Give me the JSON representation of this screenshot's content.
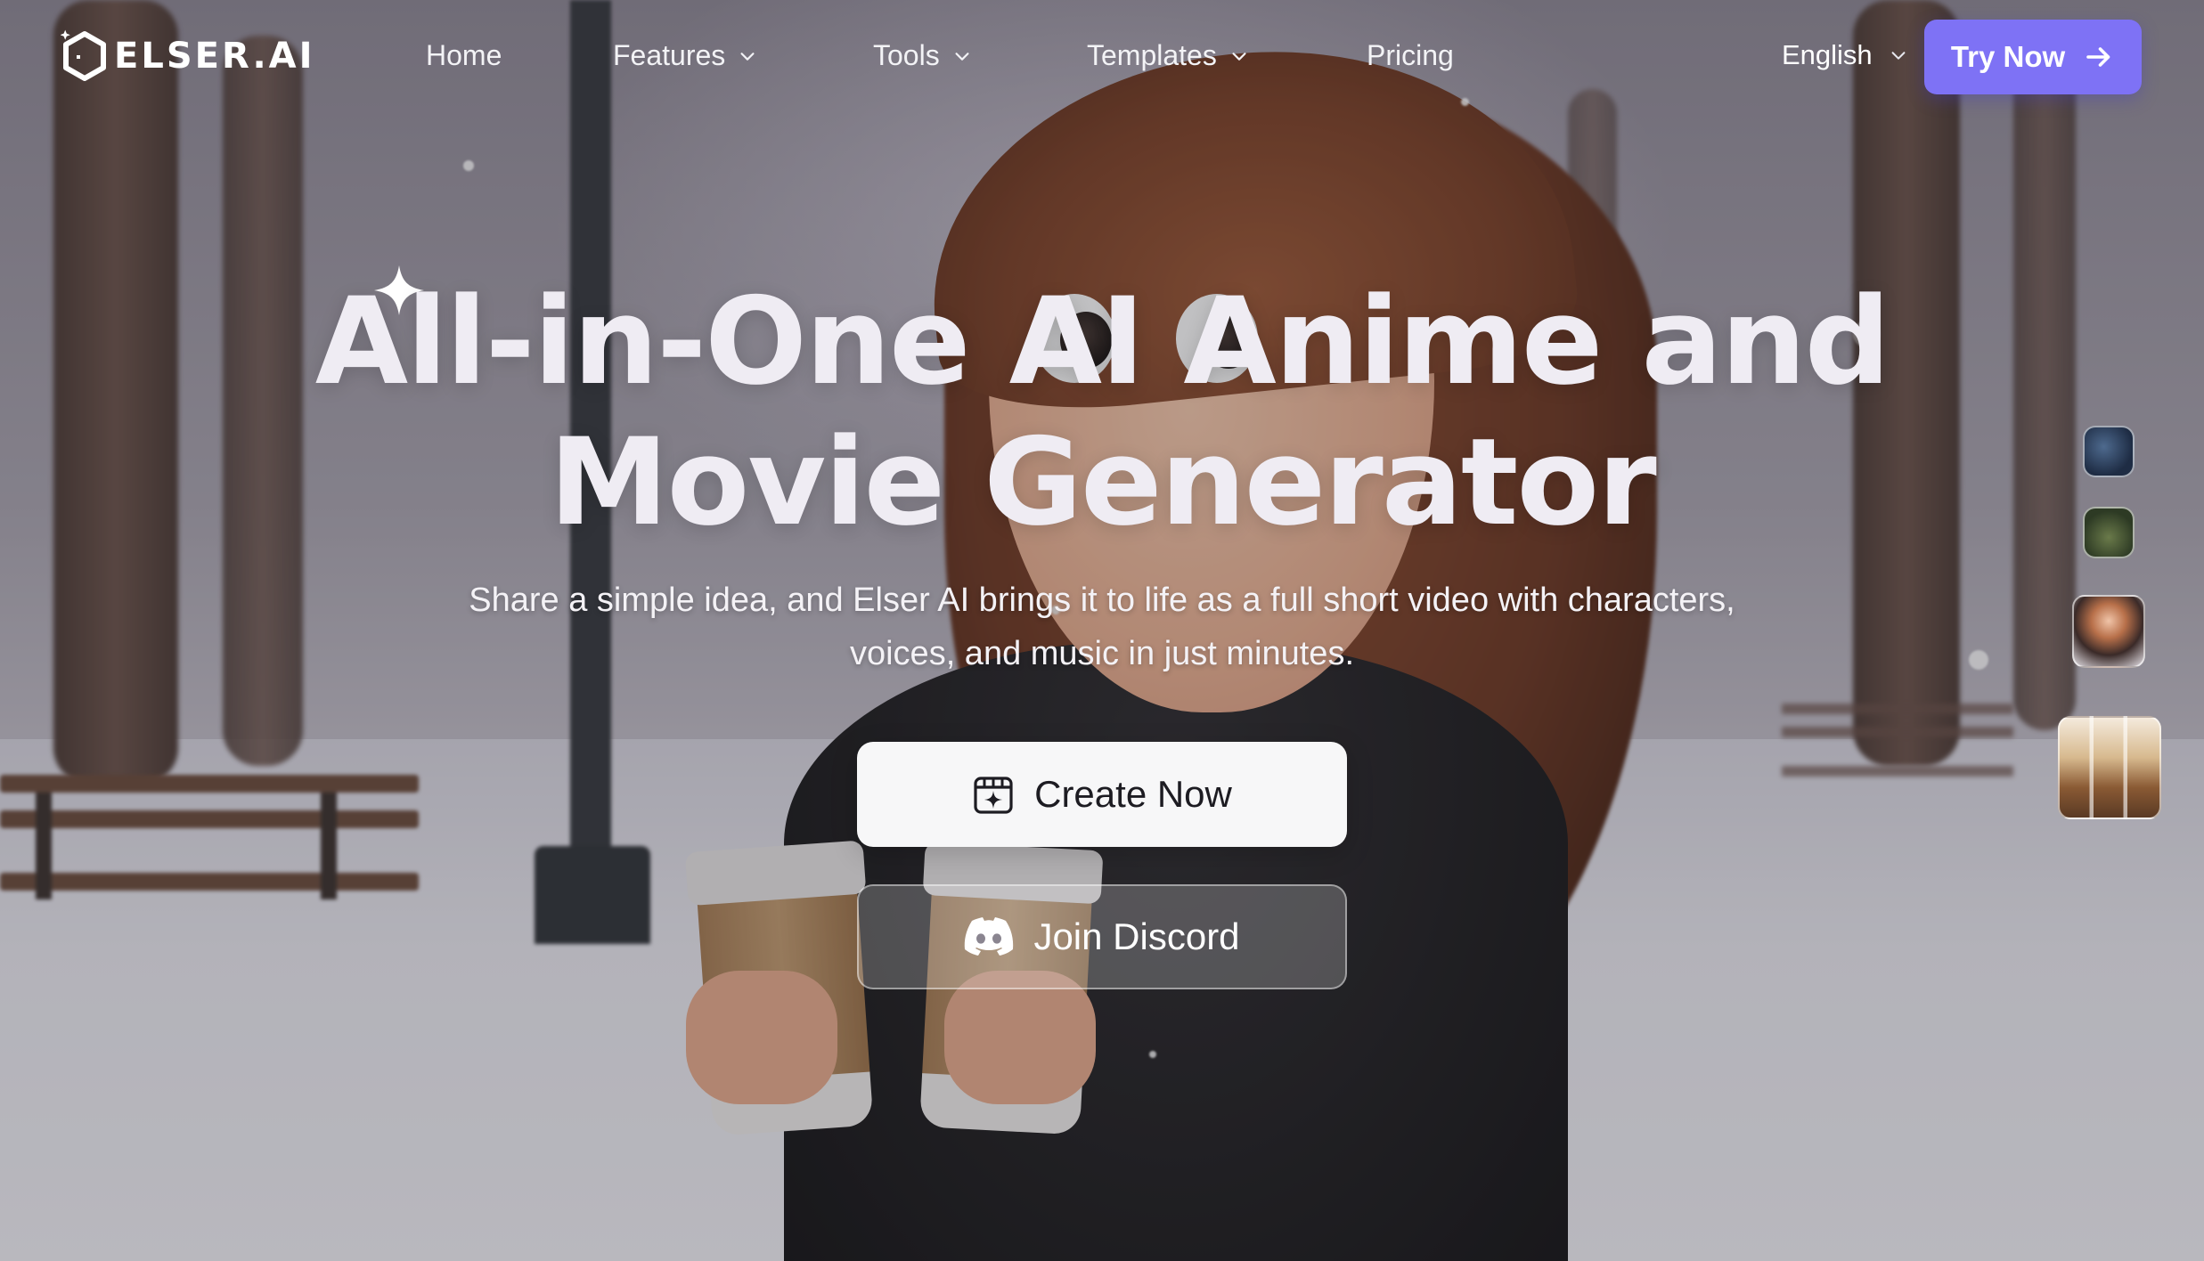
{
  "brand": {
    "name": "ELSER.AI",
    "accent": "#7e72f5"
  },
  "nav": {
    "home": "Home",
    "features": "Features",
    "tools": "Tools",
    "templates": "Templates",
    "pricing": "Pricing"
  },
  "language": {
    "selected": "English"
  },
  "cta": {
    "try_now": "Try Now"
  },
  "hero": {
    "title_line1": "All-in-One AI Anime and",
    "title_line2": "Movie Generator",
    "subtitle_line1": "Share a simple idea, and Elser AI brings it to life as a full short video with characters,",
    "subtitle_line2": "voices, and music in just minutes.",
    "create_button": "Create Now",
    "discord_button": "Join Discord"
  },
  "icons": {
    "logo": "hexagon-logo-icon",
    "chevron": "chevron-down-icon",
    "arrow": "arrow-right-icon",
    "create": "calendar-sparkle-icon",
    "discord": "discord-icon",
    "sparkle": "sparkle-icon"
  }
}
